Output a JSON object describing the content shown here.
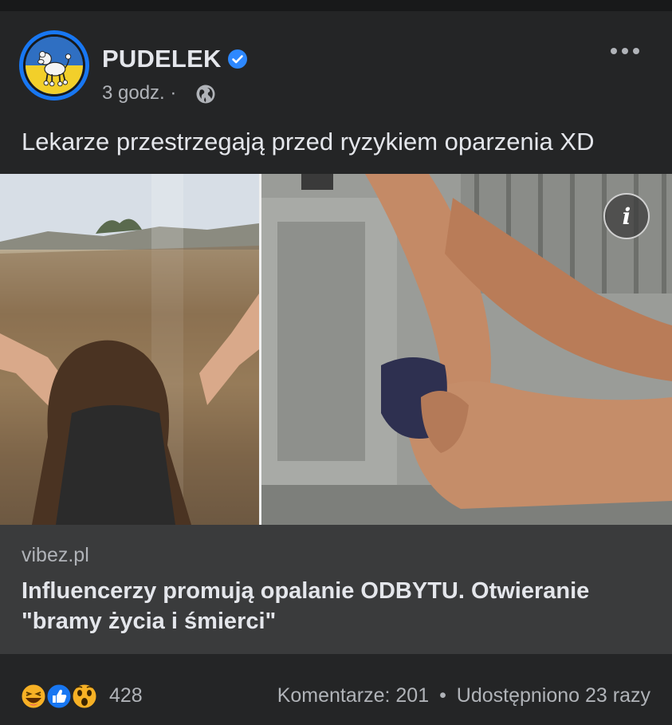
{
  "post": {
    "page_name": "PUDELEK",
    "time": "3 godz.",
    "separator": "·",
    "text": "Lekarze przestrzegają przed ryzykiem oparzenia XD"
  },
  "icons": {
    "verified": "verified-badge-icon",
    "audience": "globe-icon",
    "menu": "more-options-icon",
    "info": "info-icon"
  },
  "link_preview": {
    "domain": "vibez.pl",
    "headline": "Influencerzy promują opalanie ODBYTU. Otwieranie \"bramy życia i śmierci\"",
    "info_glyph": "i"
  },
  "footer": {
    "reaction_types": [
      "haha",
      "like",
      "wow"
    ],
    "reaction_count": "428",
    "comments": "Komentarze: 201",
    "stats_separator": "•",
    "shares": "Udostępniono 23 razy"
  },
  "colors": {
    "background": "#242526",
    "link_box": "#3a3b3c",
    "accent": "#1877f2",
    "secondary_text": "#b0b3b8"
  }
}
